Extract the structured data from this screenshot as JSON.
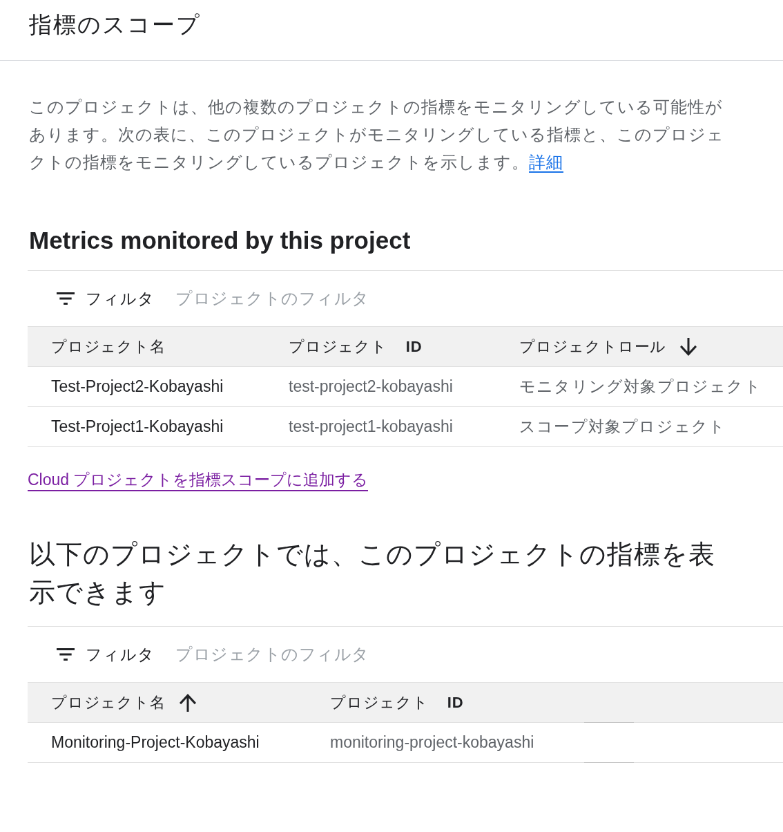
{
  "header": {
    "title": "指標のスコープ"
  },
  "intro": {
    "text": "このプロジェクトは、他の複数のプロジェクトの指標をモニタリングしている可能性があります。次の表に、このプロジェクトがモニタリングしている指標と、このプロジェクトの指標をモニタリングしているプロジェクトを示します。",
    "link": "詳細"
  },
  "sections": [
    {
      "heading": {
        "kind": "bold",
        "text": "Metrics monitored by this project"
      },
      "table": {
        "filter": {
          "label": "フィルタ",
          "placeholder": "プロジェクトのフィルタ"
        },
        "columns": [
          {
            "label": "プロジェクト名",
            "sorted": false
          },
          {
            "label": "プロジェクト **ID**",
            "sorted": false
          },
          {
            "label": "プロジェクトロール",
            "sorted": true,
            "descending": true
          }
        ],
        "rows": [
          [
            "Test-Project2-Kobayashi",
            "test-project2-kobayashi",
            "モニタリング対象プロジェクト"
          ],
          [
            "Test-Project1-Kobayashi",
            "test-project1-kobayashi",
            "スコープ対象プロジェクト"
          ]
        ]
      },
      "add_link": "Cloud プロジェクトを指標スコープに追加する"
    },
    {
      "heading": {
        "kind": "regular",
        "text": "以下のプロジェクトでは、このプロジェクトの指標を表示できます"
      },
      "table": {
        "filter": {
          "label": "フィルタ",
          "placeholder": "プロジェクトのフィルタ"
        },
        "columns": [
          {
            "label": "プロジェクト名",
            "sorted": true,
            "descending": false
          },
          {
            "label": "プロジェクト **ID**",
            "sorted": false
          }
        ],
        "rows": [
          [
            "Monitoring-Project-Kobayashi",
            "monitoring-project-kobayashi"
          ]
        ]
      }
    }
  ]
}
